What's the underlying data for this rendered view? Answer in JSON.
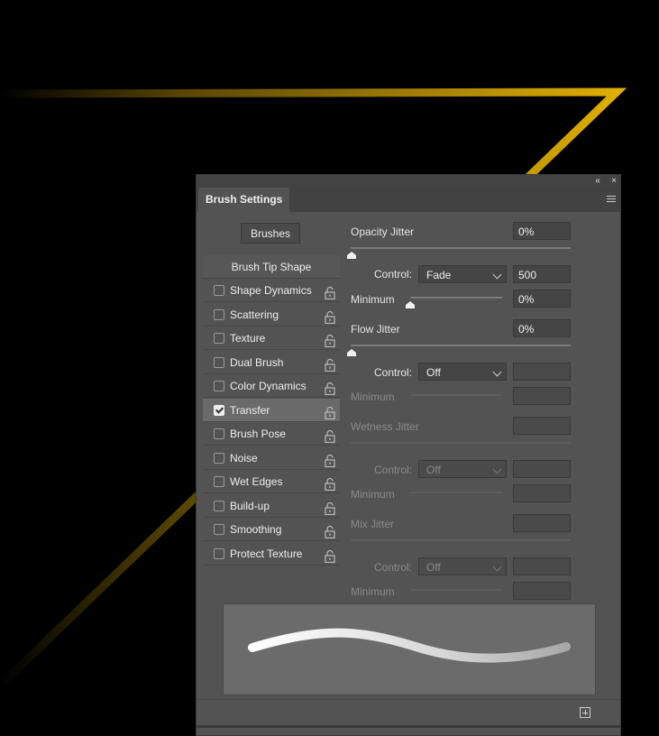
{
  "panel": {
    "tab_title": "Brush Settings",
    "collapse_glyph": "«",
    "close_glyph": "×",
    "brushes_button": "Brushes"
  },
  "sidebar": {
    "header": "Brush Tip Shape",
    "items": [
      {
        "label": "Shape Dynamics",
        "checked": false
      },
      {
        "label": "Scattering",
        "checked": false
      },
      {
        "label": "Texture",
        "checked": false
      },
      {
        "label": "Dual Brush",
        "checked": false
      },
      {
        "label": "Color Dynamics",
        "checked": false
      },
      {
        "label": "Transfer",
        "checked": true
      },
      {
        "label": "Brush Pose",
        "checked": false
      },
      {
        "label": "Noise",
        "checked": false
      },
      {
        "label": "Wet Edges",
        "checked": false
      },
      {
        "label": "Build-up",
        "checked": false
      },
      {
        "label": "Smoothing",
        "checked": false
      },
      {
        "label": "Protect Texture",
        "checked": false
      }
    ]
  },
  "transfer": {
    "opacity_jitter": {
      "label": "Opacity Jitter",
      "value": "0%",
      "level": 0
    },
    "opacity_control": {
      "label": "Control:",
      "value": "Fade",
      "steps": "500"
    },
    "opacity_minimum": {
      "label": "Minimum",
      "value": "0%",
      "level": 0
    },
    "flow_jitter": {
      "label": "Flow Jitter",
      "value": "0%",
      "level": 0
    },
    "flow_control": {
      "label": "Control:",
      "value": "Off"
    },
    "flow_minimum": {
      "label": "Minimum"
    },
    "wetness_jitter": {
      "label": "Wetness Jitter"
    },
    "wetness_control": {
      "label": "Control:",
      "value": "Off"
    },
    "wetness_minimum": {
      "label": "Minimum"
    },
    "mix_jitter": {
      "label": "Mix Jitter"
    },
    "mix_control": {
      "label": "Control:",
      "value": "Off"
    },
    "mix_minimum": {
      "label": "Minimum"
    }
  },
  "colors": {
    "canvas": "#000000",
    "stroke": "#e8b400",
    "panel": "#535353"
  }
}
